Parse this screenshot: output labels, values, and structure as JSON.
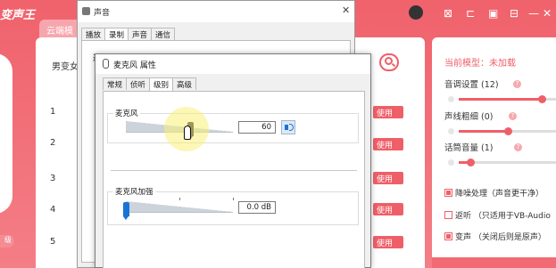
{
  "app": {
    "logo": "变声王",
    "tab_label": "云端模",
    "voice_label": "男变女",
    "row_numbers": [
      "1",
      "2",
      "3",
      "4",
      "5"
    ],
    "use_label": "使用",
    "left_pill": "级",
    "top_icons": [
      "⊠",
      "⊏",
      "▣",
      "⊟",
      "—",
      "✕"
    ],
    "current_model_label": "当前模型：未加载",
    "sliders": [
      {
        "label": "音调设置 (12)",
        "value": 12,
        "fraction": 0.85
      },
      {
        "label": "声线粗细 (0)",
        "value": 0,
        "fraction": 0.5
      },
      {
        "label": "话筒音量 (1)",
        "value": 1,
        "fraction": 0.12
      }
    ],
    "checks": [
      {
        "label": "降噪处理（声音更干净）",
        "checked": true
      },
      {
        "label": "返听 （只适用于VB-Audio",
        "checked": false
      },
      {
        "label": "变声 （关闭后则是原声）",
        "checked": true
      }
    ],
    "accent": "#ef5f68"
  },
  "sound_dialog": {
    "title": "声音",
    "tabs": [
      "播放",
      "录制",
      "声音",
      "通信"
    ],
    "selected_tab": 1,
    "hint": "选"
  },
  "prop_dialog": {
    "title": "麦克风 属性",
    "tabs": [
      "常规",
      "侦听",
      "级别",
      "高级"
    ],
    "selected_tab": 2,
    "mic": {
      "label": "麦克风",
      "value": "60",
      "level_fraction": 0.6
    },
    "boost": {
      "label": "麦克风加强",
      "value": "0.0 dB",
      "level_fraction": 0.0
    }
  }
}
